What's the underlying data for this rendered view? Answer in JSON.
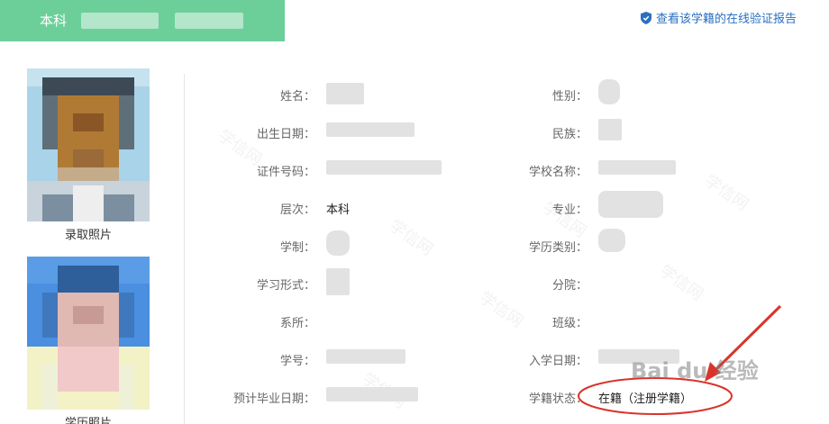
{
  "header": {
    "tab_title": "本科",
    "verify_link": "查看该学籍的在线验证报告",
    "verify_icon": "shield-check-icon"
  },
  "photos": [
    {
      "label": "录取照片"
    },
    {
      "label": "学历照片"
    }
  ],
  "left_fields": [
    {
      "label": "姓名：",
      "value": ""
    },
    {
      "label": "出生日期：",
      "value": ""
    },
    {
      "label": "证件号码：",
      "value": ""
    },
    {
      "label": "层次：",
      "value": "本科"
    },
    {
      "label": "学制：",
      "value": ""
    },
    {
      "label": "学习形式：",
      "value": ""
    },
    {
      "label": "系所：",
      "value": ""
    },
    {
      "label": "学号：",
      "value": ""
    },
    {
      "label": "预计毕业日期：",
      "value": ""
    }
  ],
  "right_fields": [
    {
      "label": "性别：",
      "value": ""
    },
    {
      "label": "民族：",
      "value": ""
    },
    {
      "label": "学校名称：",
      "value": ""
    },
    {
      "label": "专业：",
      "value": ""
    },
    {
      "label": "学历类别：",
      "value": ""
    },
    {
      "label": "分院：",
      "value": ""
    },
    {
      "label": "班级：",
      "value": ""
    },
    {
      "label": "入学日期：",
      "value": ""
    },
    {
      "label": "学籍状态：",
      "value": "在籍（注册学籍）"
    }
  ],
  "watermark": {
    "text": "学信网",
    "baidu": "Bai du 经验"
  },
  "colors": {
    "tab_green": "#6ccf9a",
    "link_blue": "#2a6fc0",
    "annotation_red": "#d9342b"
  }
}
